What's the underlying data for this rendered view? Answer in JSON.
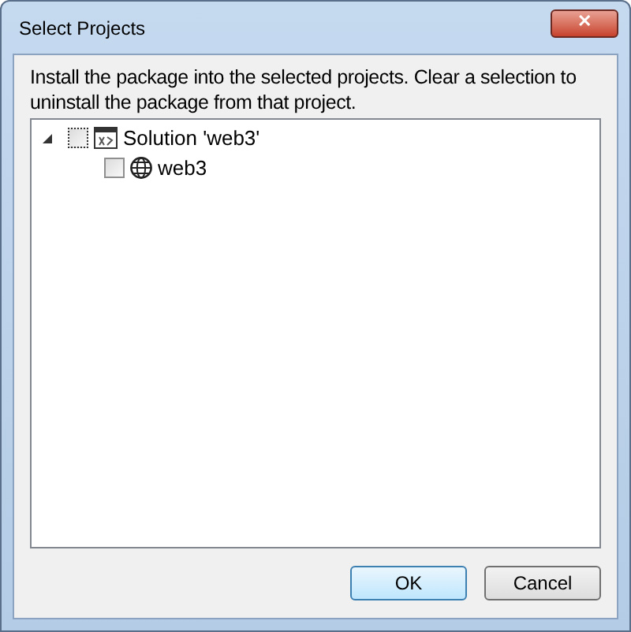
{
  "window": {
    "title": "Select Projects",
    "close": "✕"
  },
  "instructions": "Install the package into the selected projects. Clear a selection to uninstall the package from that project.",
  "tree": [
    {
      "label": "Solution 'web3'",
      "kind": "solution",
      "expanded": true,
      "checked": false,
      "focused": true,
      "children": [
        {
          "label": "web3",
          "kind": "project",
          "checked": false,
          "focused": false
        }
      ]
    }
  ],
  "buttons": [
    {
      "label": "OK",
      "default": true
    },
    {
      "label": "Cancel",
      "default": false
    }
  ]
}
